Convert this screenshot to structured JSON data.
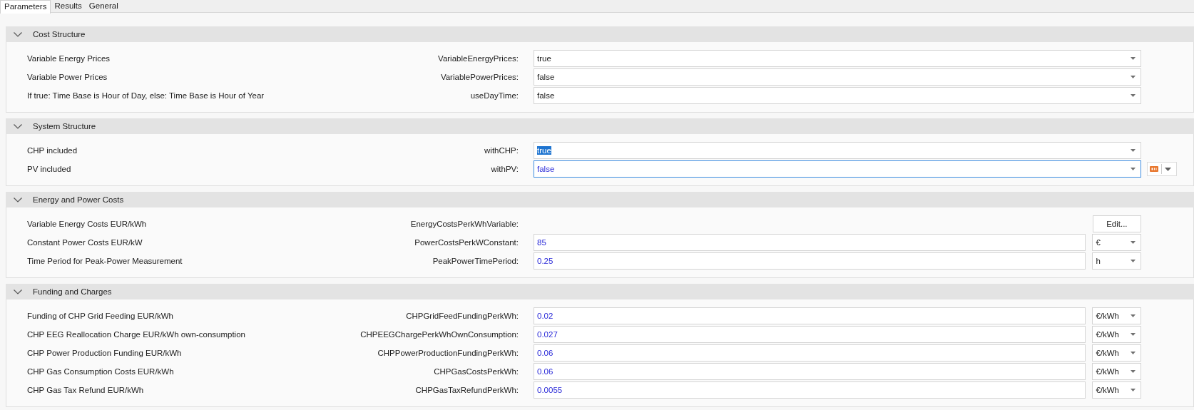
{
  "tabs": [
    {
      "label": "Parameters",
      "selected": true
    },
    {
      "label": "Results",
      "selected": false
    },
    {
      "label": "General",
      "selected": false
    }
  ],
  "sections": [
    {
      "title": "Cost Structure",
      "expanded": true,
      "rows": [
        {
          "kind": "dropdown",
          "label": "Variable Energy Prices",
          "key": "VariableEnergyPrices:",
          "value": "true",
          "modified": false,
          "focused": false,
          "text_selected": false,
          "extra_button": false
        },
        {
          "kind": "dropdown",
          "label": "Variable Power Prices",
          "key": "VariablePowerPrices:",
          "value": "false",
          "modified": false,
          "focused": false,
          "text_selected": false,
          "extra_button": false
        },
        {
          "kind": "dropdown",
          "label": "If true: Time Base is Hour of Day, else: Time Base is Hour of Year",
          "key": "useDayTime:",
          "value": "false",
          "modified": false,
          "focused": false,
          "text_selected": false,
          "extra_button": false
        }
      ]
    },
    {
      "title": "System Structure",
      "expanded": true,
      "rows": [
        {
          "kind": "dropdown",
          "label": "CHP included",
          "key": "withCHP:",
          "value": "true",
          "modified": false,
          "focused": false,
          "text_selected": true,
          "extra_button": false
        },
        {
          "kind": "dropdown",
          "label": "PV included",
          "key": "withPV:",
          "value": "false",
          "modified": true,
          "focused": true,
          "text_selected": false,
          "extra_button": true
        }
      ]
    },
    {
      "title": "Energy and Power Costs",
      "expanded": true,
      "rows": [
        {
          "kind": "edit",
          "label": "Variable Energy Costs EUR/kWh",
          "key": "EnergyCostsPerkWhVariable:",
          "button": "Edit..."
        },
        {
          "kind": "number",
          "label": "Constant Power Costs EUR/kW",
          "key": "PowerCostsPerkWConstant:",
          "value": "85",
          "modified": true,
          "unit": "€"
        },
        {
          "kind": "number",
          "label": "Time Period for Peak-Power Measurement",
          "key": "PeakPowerTimePeriod:",
          "value": "0.25",
          "modified": true,
          "unit": "h"
        }
      ]
    },
    {
      "title": "Funding and Charges",
      "expanded": true,
      "rows": [
        {
          "kind": "number",
          "label": "Funding of CHP Grid Feeding EUR/kWh",
          "key": "CHPGridFeedFundingPerkWh:",
          "value": "0.02",
          "modified": true,
          "unit": "€/kWh"
        },
        {
          "kind": "number",
          "label": "CHP EEG Reallocation Charge EUR/kWh own-consumption",
          "key": "CHPEEGChargePerkWhOwnConsumption:",
          "value": "0.027",
          "modified": true,
          "unit": "€/kWh"
        },
        {
          "kind": "number",
          "label": "CHP Power Production Funding EUR/kWh",
          "key": "CHPPowerProductionFundingPerkWh:",
          "value": "0.06",
          "modified": true,
          "unit": "€/kWh"
        },
        {
          "kind": "number",
          "label": "CHP Gas Consumption Costs EUR/kWh",
          "key": "CHPGasCostsPerkWh:",
          "value": "0.06",
          "modified": true,
          "unit": "€/kWh"
        },
        {
          "kind": "number",
          "label": "CHP Gas Tax Refund EUR/kWh",
          "key": "CHPGasTaxRefundPerkWh:",
          "value": "0.0055",
          "modified": true,
          "unit": "€/kWh"
        }
      ]
    }
  ]
}
